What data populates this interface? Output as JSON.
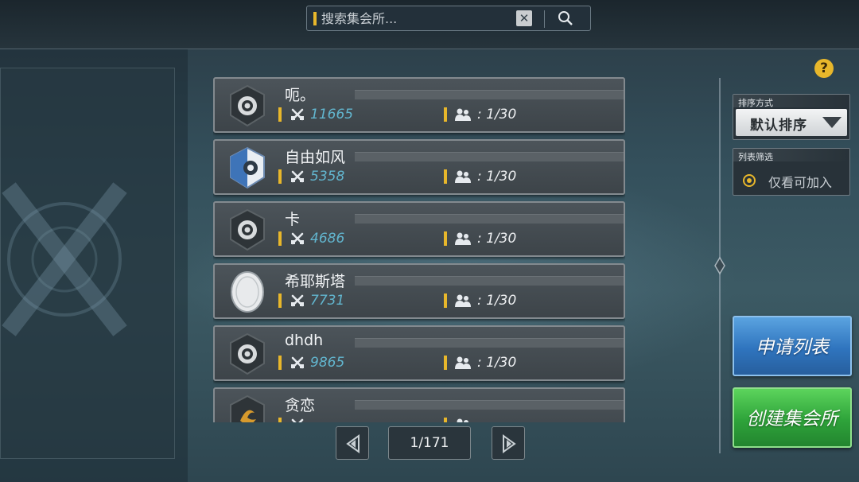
{
  "search": {
    "placeholder": "搜索集会所...",
    "value": ""
  },
  "help": {
    "label": "?"
  },
  "guilds": [
    {
      "name": "呃。",
      "power": "11665",
      "members": ": 1/30",
      "emblem": "lion-emblem-icon"
    },
    {
      "name": "自由如风",
      "power": "5358",
      "members": ": 1/30",
      "emblem": "blue-beast-emblem-icon"
    },
    {
      "name": "卡",
      "power": "4686",
      "members": ": 1/30",
      "emblem": "lion-emblem-icon"
    },
    {
      "name": "希耶斯塔",
      "power": "7731",
      "members": ": 1/30",
      "emblem": "white-oval-emblem-icon"
    },
    {
      "name": "dhdh",
      "power": "9865",
      "members": ": 1/30",
      "emblem": "lion-emblem-icon"
    },
    {
      "name": "贪恋",
      "power": "",
      "members": "",
      "emblem": "dragon-emblem-icon"
    }
  ],
  "pagination": {
    "current": "1/171"
  },
  "sort": {
    "title": "排序方式",
    "value": "默认排序"
  },
  "filter": {
    "title": "列表筛选",
    "option": "仅看可加入",
    "selected": true
  },
  "buttons": {
    "apply": "申请列表",
    "create": "创建集会所"
  },
  "colors": {
    "accent": "#e8b72b",
    "power_text": "#62b6cf",
    "apply_button": "#2f74be",
    "create_button": "#2ea33a"
  }
}
